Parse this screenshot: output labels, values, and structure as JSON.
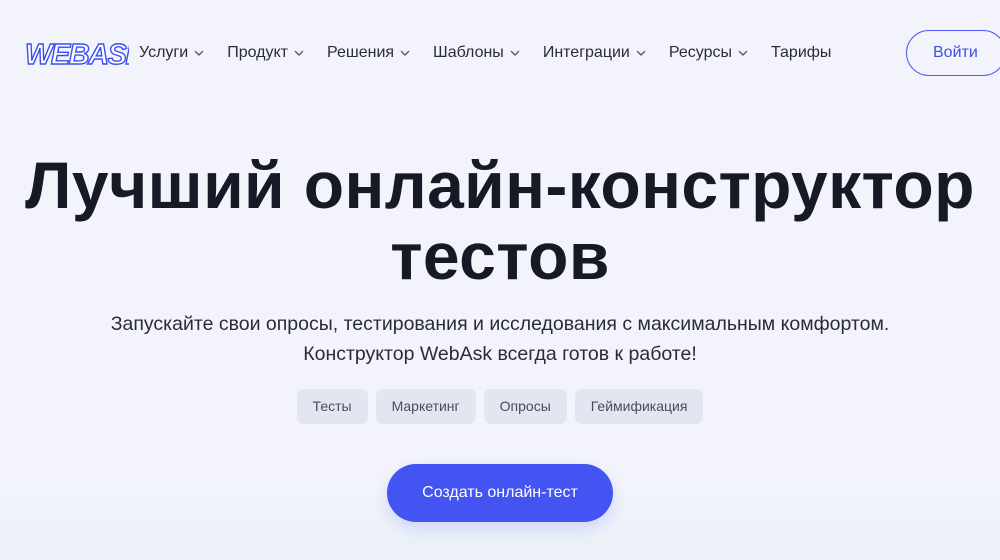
{
  "header": {
    "logo_text": "WEBASK",
    "nav": [
      {
        "label": "Услуги",
        "has_dropdown": true
      },
      {
        "label": "Продукт",
        "has_dropdown": true
      },
      {
        "label": "Решения",
        "has_dropdown": true
      },
      {
        "label": "Шаблоны",
        "has_dropdown": true
      },
      {
        "label": "Интеграции",
        "has_dropdown": true
      },
      {
        "label": "Ресурсы",
        "has_dropdown": true
      },
      {
        "label": "Тарифы",
        "has_dropdown": false
      }
    ],
    "login_label": "Войти"
  },
  "hero": {
    "title_line1": "Лучший онлайн-конструктор",
    "title_line2": "тестов",
    "subtitle_line1": "Запускайте свои опросы, тестирования и исследования с максимальным комфортом.",
    "subtitle_line2": "Конструктор WebAsk всегда готов к работе!",
    "tags": [
      "Тесты",
      "Маркетинг",
      "Опросы",
      "Геймификация"
    ],
    "cta_label": "Создать онлайн-тест"
  },
  "colors": {
    "background": "#f3f4fb",
    "accent": "#4354f2",
    "text": "#181926",
    "tag_bg": "#e3e6f0"
  },
  "icons": {
    "nav_dropdown": "chevron-down-icon",
    "logo": "webask-logo"
  }
}
